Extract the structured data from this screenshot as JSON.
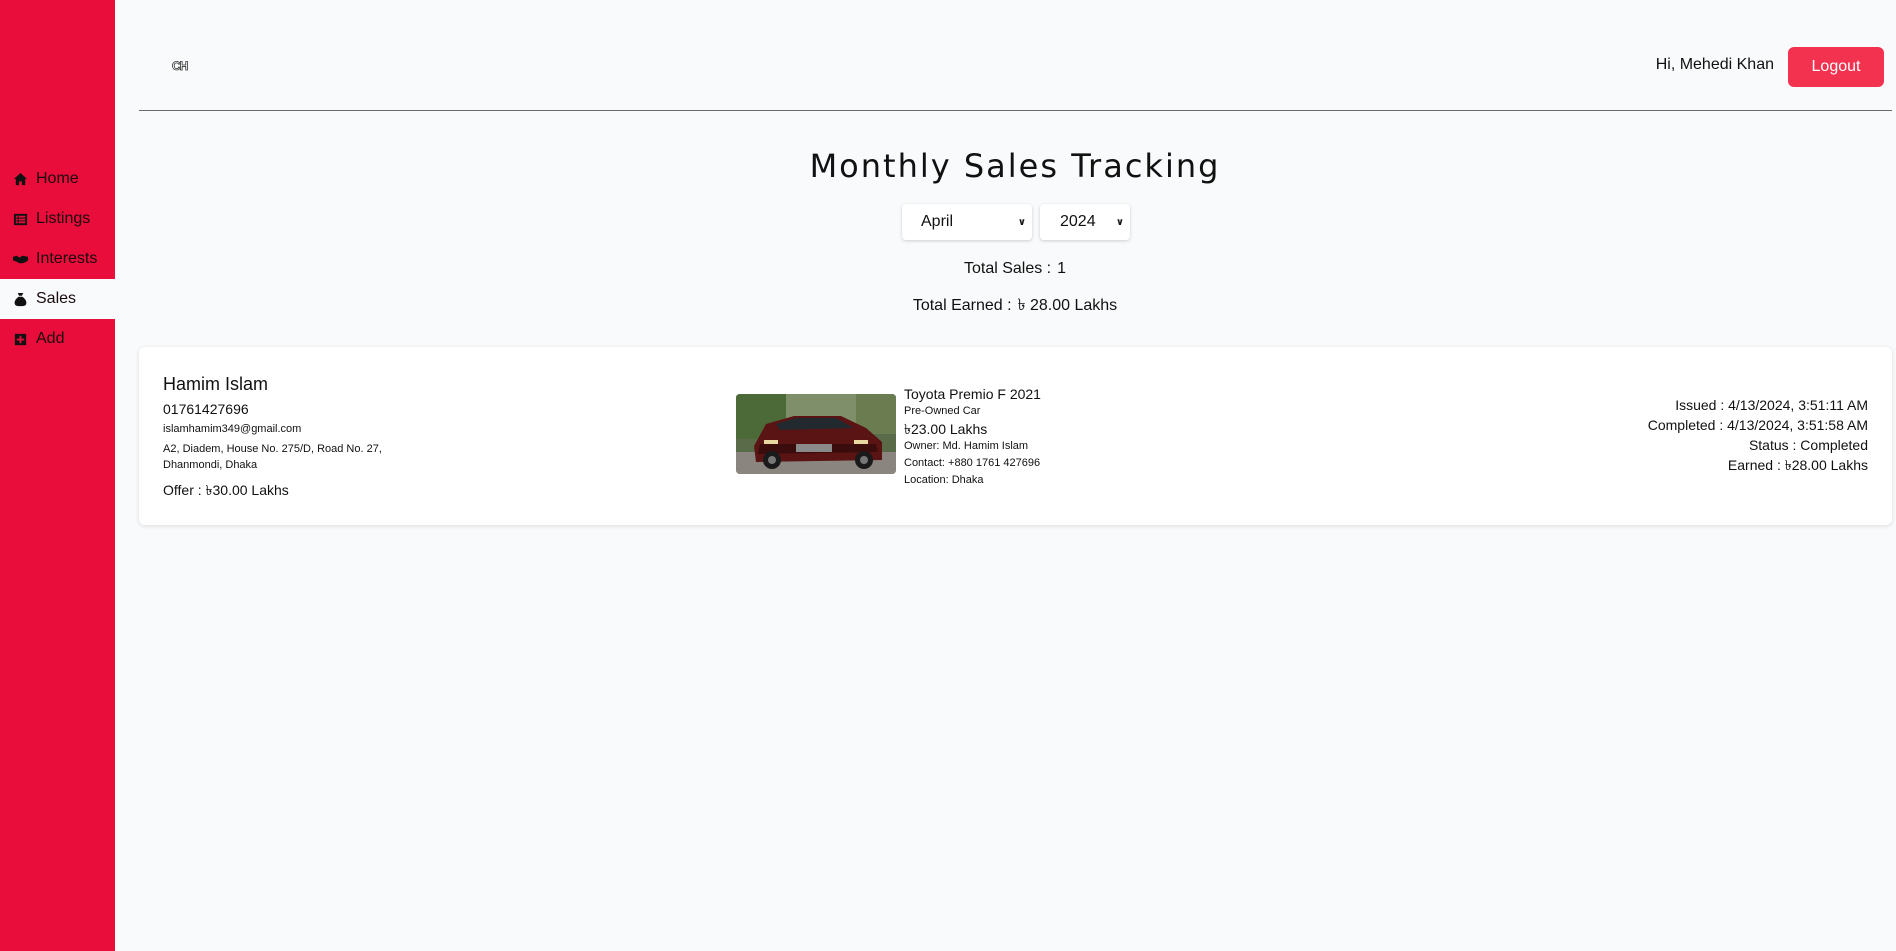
{
  "sidebar": {
    "items": [
      {
        "label": "Home",
        "icon": "home-icon",
        "active": false
      },
      {
        "label": "Listings",
        "icon": "list-icon",
        "active": false
      },
      {
        "label": "Interests",
        "icon": "handshake-icon",
        "active": false
      },
      {
        "label": "Sales",
        "icon": "money-bag-icon",
        "active": true
      },
      {
        "label": "Add",
        "icon": "plus-square-icon",
        "active": false
      }
    ],
    "color": "#e90d3b"
  },
  "header": {
    "brand": "CH",
    "greeting": "Hi, Mehedi Khan",
    "logout_label": "Logout",
    "logout_color": "#f3324f"
  },
  "page": {
    "title": "Monthly Sales Tracking",
    "month": "April",
    "year": "2024",
    "total_sales_label": "Total Sales :",
    "total_sales_value": "1",
    "total_earned_label": "Total Earned :",
    "total_earned_value": "৳ 28.00 Lakhs"
  },
  "sale": {
    "buyer_name": "Hamim Islam",
    "buyer_phone": "01761427696",
    "buyer_email": "islamhamim349@gmail.com",
    "buyer_address": "A2, Diadem, House No. 275/D, Road No. 27, Dhanmondi, Dhaka",
    "offer": "Offer :  ৳30.00 Lakhs",
    "car_name": "Toyota Premio F 2021",
    "car_condition": "Pre-Owned Car",
    "car_price": "৳23.00 Lakhs",
    "car_owner": "Owner: Md. Hamim Islam",
    "car_contact": "Contact: +880 1761 427696",
    "car_location": "Location: Dhaka",
    "issued": "Issued : 4/13/2024, 3:51:11 AM",
    "completed": "Completed : 4/13/2024, 3:51:58 AM",
    "status": "Status : Completed",
    "earned": "Earned : ৳28.00 Lakhs"
  }
}
